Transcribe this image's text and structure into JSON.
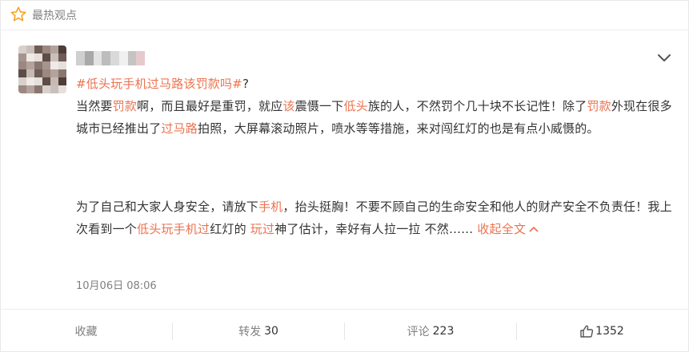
{
  "header": {
    "title": "最热观点",
    "icon": "star-icon",
    "icon_color": "#f5a623"
  },
  "post": {
    "topic": "#低头玩手机过马路该罚款吗#",
    "topic_suffix": "?",
    "para1": [
      {
        "t": "当然要"
      },
      {
        "t": "罚款",
        "link": true
      },
      {
        "t": "啊，而且最好是重罚，就应"
      },
      {
        "t": "该",
        "link": true
      },
      {
        "t": "震慑一下"
      },
      {
        "t": "低头",
        "link": true
      },
      {
        "t": "族的人，不然罚个几十块不长记性！除了"
      },
      {
        "t": "罚款",
        "link": true
      },
      {
        "t": "外现在很多城市已经推出了"
      },
      {
        "t": "过马路",
        "link": true
      },
      {
        "t": "拍照，大屏幕滚动照片，喷水等等措施，来对闯红灯的也是有点小威慑的。"
      }
    ],
    "para2": [
      {
        "t": "为了自己和大家人身安全，请放下"
      },
      {
        "t": "手机",
        "link": true
      },
      {
        "t": "，抬头挺胸！不要不顾自己的生命安全和他人的财产安全不负责任！我上次看到一个"
      },
      {
        "t": "低头玩手机过",
        "link": true
      },
      {
        "t": "红灯的 "
      },
      {
        "t": "玩过",
        "link": true
      },
      {
        "t": "神了估计，幸好有人拉一拉 不然……"
      }
    ],
    "collapse_label": "收起全文",
    "time": "10月06日 08:06"
  },
  "footer": {
    "favorite": "收藏",
    "repost_label": "转发",
    "repost_count": "30",
    "comment_label": "评论",
    "comment_count": "223",
    "like_count": "1352",
    "like_icon": "thumbs-up-icon"
  },
  "colors": {
    "link": "#eb7350",
    "text": "#333333",
    "muted": "#808080"
  }
}
